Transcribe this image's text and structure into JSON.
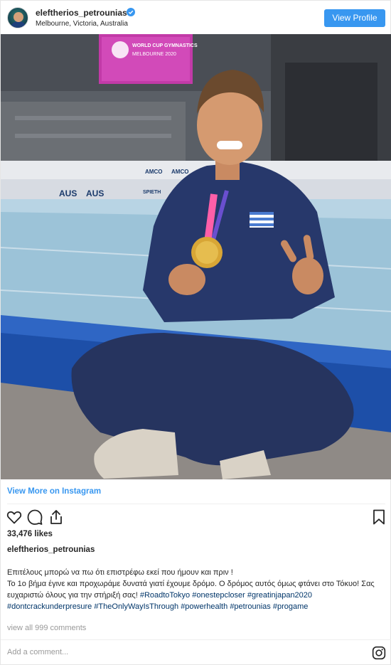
{
  "header": {
    "username": "eleftherios_petrounias",
    "verified_icon": "verified-badge-icon",
    "location": "Melbourne, Victoria, Australia",
    "view_profile_label": "View Profile"
  },
  "photo": {
    "arena_screen_text": "WORLD CUP GYMNASTICS",
    "arena_screen_subtext": "MELBOURNE 2020",
    "banner_text": [
      "AUS",
      "AUS",
      "AMCO",
      "AMCO",
      "SPIETH"
    ]
  },
  "post": {
    "view_more_label": "View More on Instagram",
    "likes": "33,476 likes",
    "author": "eleftherios_petrounias",
    "caption_line1": "Επιτέλους μπορώ να πω ότι επιστρέφω εκεί που ήμουν και πριν !",
    "caption_line2": "Το 1ο βήμα έγινε και προχωράμε δυνατά γιατί έχουμε δρόμο. Ο δρόμος αυτός όμως φτάνει στο Τόκυο! Σας ευχαριστώ όλους για την στήριξή σας!",
    "hashtags": [
      "#RoadtoTokyo",
      "#onestepcloser",
      "#greatinjapan2020",
      "#dontcrackunderpresure",
      "#TheOnlyWayIsThrough",
      "#powerhealth",
      "#petrounias",
      "#progame"
    ],
    "comments_label": "view all 999 comments",
    "add_comment_placeholder": "Add a comment..."
  },
  "icons": {
    "like": "heart-icon",
    "comment": "comment-icon",
    "share": "share-icon",
    "save": "bookmark-icon",
    "instagram": "instagram-logo-icon"
  },
  "colors": {
    "accent": "#3897f0",
    "hashtag": "#003569"
  }
}
